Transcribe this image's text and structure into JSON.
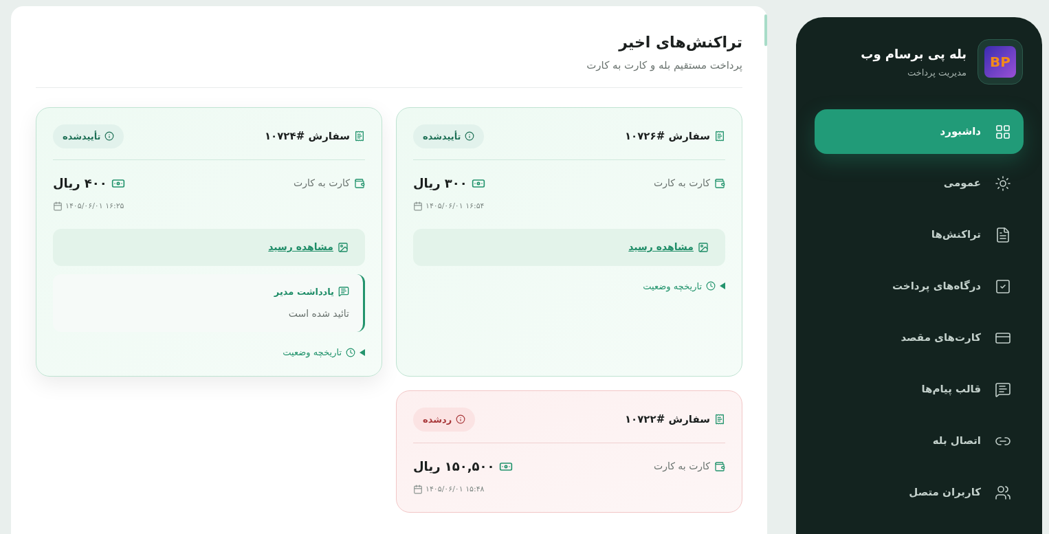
{
  "brand": {
    "logo_text": "BP",
    "name": "بله پی برسام وب",
    "subtitle": "مدیریت پرداخت"
  },
  "nav": [
    {
      "label": "داشبورد",
      "selected": true
    },
    {
      "label": "عمومی",
      "selected": false
    },
    {
      "label": "تراکنش‌ها",
      "selected": false
    },
    {
      "label": "درگاه‌های پرداخت",
      "selected": false
    },
    {
      "label": "کارت‌های مقصد",
      "selected": false
    },
    {
      "label": "قالب پیام‌ها",
      "selected": false
    },
    {
      "label": "اتصال بله",
      "selected": false
    },
    {
      "label": "کاربران متصل",
      "selected": false
    }
  ],
  "section": {
    "title": "تراکنش‌های اخیر",
    "subtitle": "پرداخت مستقیم بله و کارت به کارت"
  },
  "transactions": [
    {
      "order": "سفارش #۱۰۷۲۶",
      "status": {
        "kind": "approved",
        "label": "تأییدشده"
      },
      "method": "کارت به کارت",
      "amount": "۳۰۰ ریال",
      "date": "۱۴۰۵/۰۶/۰۱ ۱۶:۵۴",
      "receipt_link": "مشاهده رسید",
      "history": "تاریخچه وضعیت"
    },
    {
      "order": "سفارش #۱۰۷۲۴",
      "status": {
        "kind": "approved",
        "label": "تأییدشده"
      },
      "method": "کارت به کارت",
      "amount": "۴۰۰ ریال",
      "date": "۱۴۰۵/۰۶/۰۱ ۱۶:۲۵",
      "receipt_link": "مشاهده رسید",
      "note": {
        "title": "یادداشت مدیر",
        "text": "تائید شده است"
      },
      "history": "تاریخچه وضعیت"
    },
    {
      "order": "سفارش #۱۰۷۲۲",
      "status": {
        "kind": "rejected",
        "label": "ردشده"
      },
      "method": "کارت به کارت",
      "amount": "۱۵۰,۵۰۰ ریال",
      "date": "۱۴۰۵/۰۶/۰۱ ۱۵:۴۸"
    }
  ]
}
